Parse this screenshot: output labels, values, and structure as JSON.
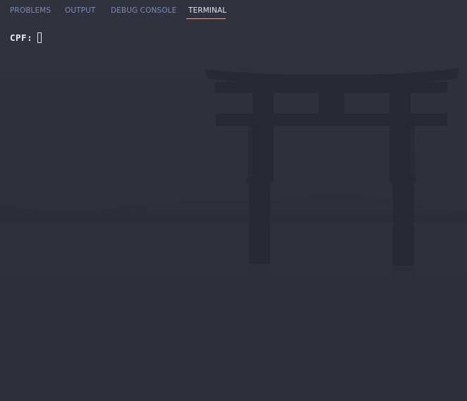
{
  "panel": {
    "tabs": [
      {
        "label": "PROBLEMS",
        "active": false
      },
      {
        "label": "OUTPUT",
        "active": false
      },
      {
        "label": "DEBUG CONSOLE",
        "active": false
      },
      {
        "label": "TERMINAL",
        "active": true
      }
    ]
  },
  "terminal": {
    "prompt": "CPF:",
    "input_value": ""
  },
  "theme": {
    "background": "#2f313d",
    "tab_inactive": "#7f89b8",
    "tab_active": "#e4e6ef",
    "active_underline": "#d8a9a1",
    "terminal_text": "#eceef4"
  },
  "background_image": {
    "icon": "torii-gate-in-mist-icon"
  }
}
